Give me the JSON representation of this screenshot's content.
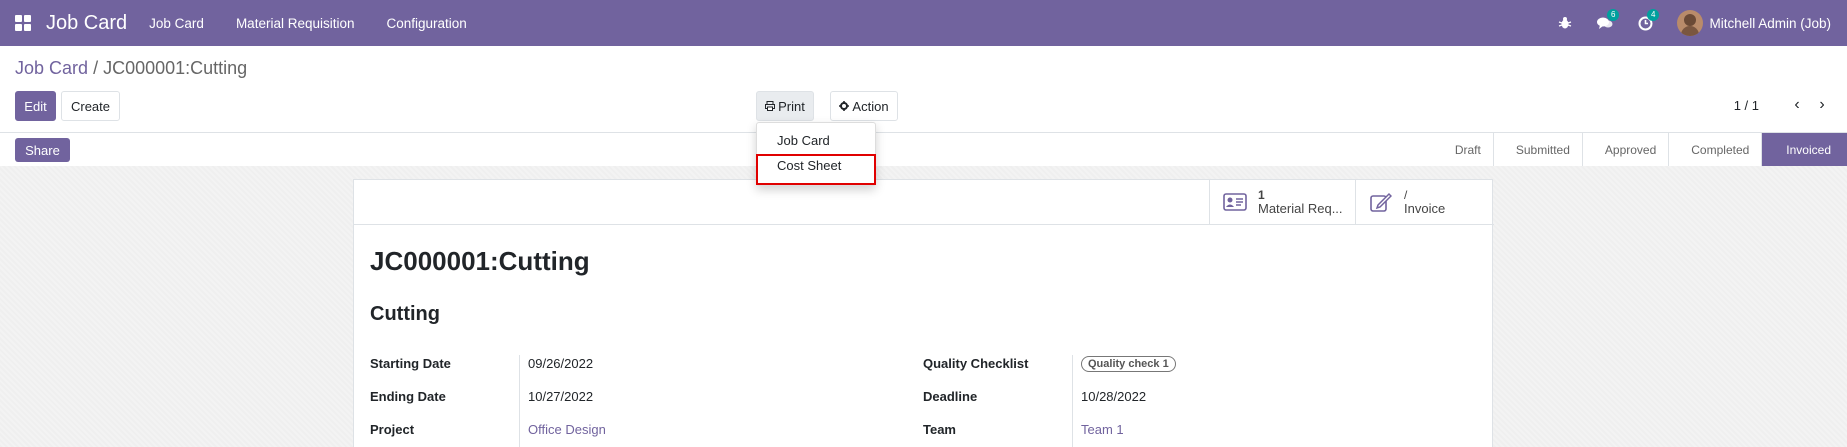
{
  "navbar": {
    "app_name": "Job Card",
    "menus": [
      "Job Card",
      "Material Requisition",
      "Configuration"
    ],
    "messages_badge": "6",
    "activities_badge": "4",
    "user_name": "Mitchell Admin (Job)"
  },
  "breadcrumb": {
    "parent": "Job Card",
    "separator": "/",
    "current": "JC000001:Cutting"
  },
  "buttons": {
    "edit": "Edit",
    "create": "Create",
    "print": "Print",
    "action": "Action",
    "share": "Share"
  },
  "print_menu": {
    "items": [
      "Job Card",
      "Cost Sheet"
    ],
    "highlighted": "Cost Sheet"
  },
  "pager": {
    "value": "1 / 1"
  },
  "stages": [
    "Draft",
    "Submitted",
    "Approved",
    "Completed",
    "Invoiced"
  ],
  "active_stage": "Invoiced",
  "smart_buttons": {
    "material": {
      "value": "1",
      "label": "Material Req..."
    },
    "invoice": {
      "value": "/",
      "label": "Invoice"
    }
  },
  "record": {
    "title": "JC000001:Cutting",
    "subtitle": "Cutting"
  },
  "fields": {
    "starting_date": {
      "label": "Starting Date",
      "value": "09/26/2022"
    },
    "ending_date": {
      "label": "Ending Date",
      "value": "10/27/2022"
    },
    "project": {
      "label": "Project",
      "value": "Office Design"
    },
    "quality_checklist": {
      "label": "Quality Checklist",
      "value": "Quality check 1"
    },
    "deadline": {
      "label": "Deadline",
      "value": "10/28/2022"
    },
    "team": {
      "label": "Team",
      "value": "Team 1"
    }
  },
  "colors": {
    "brand": "#71639e",
    "highlight": "#e00000"
  }
}
